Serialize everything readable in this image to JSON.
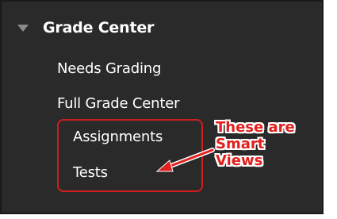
{
  "sidebar": {
    "section_title": "Grade Center",
    "items": [
      {
        "label": "Needs Grading"
      },
      {
        "label": "Full Grade Center"
      },
      {
        "label": "Assignments"
      },
      {
        "label": "Tests"
      }
    ]
  },
  "annotation": {
    "lines": [
      "These are",
      "Smart",
      "Views"
    ],
    "color": "#e0201e",
    "box_color": "#d01e1e"
  },
  "icons": {
    "collapse": "triangle-down-icon",
    "pointer": "arrow-icon"
  }
}
